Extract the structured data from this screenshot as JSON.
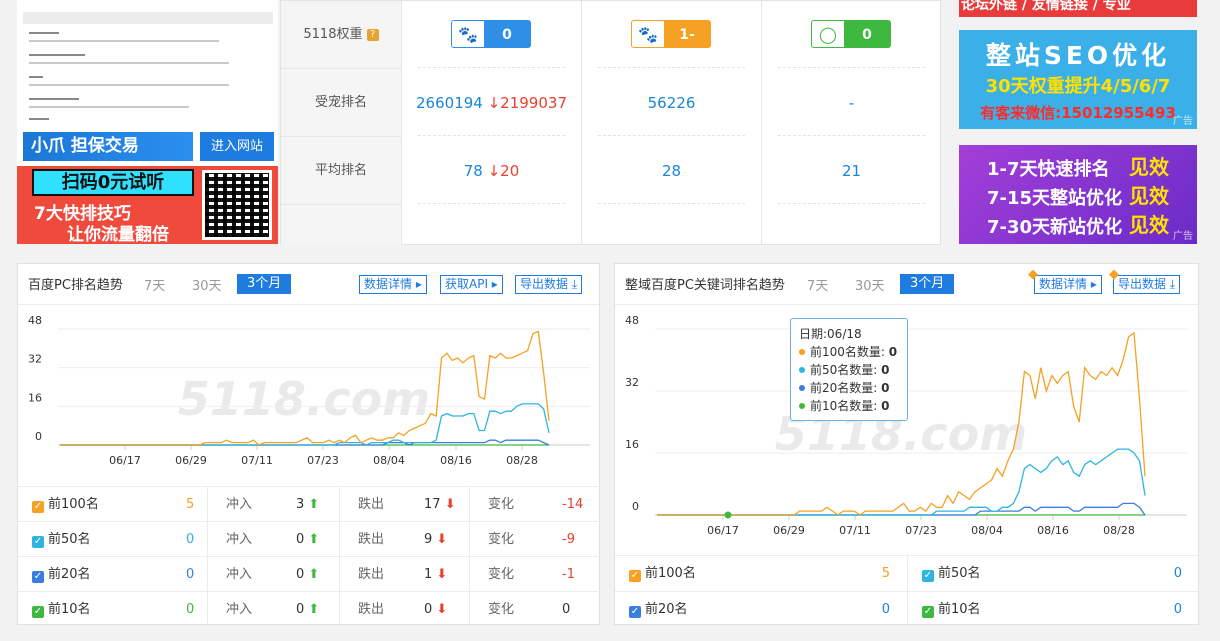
{
  "ads": {
    "enter_site": "进入网站",
    "xiaozhua": "小爪 担保交易",
    "trial_highlight": "扫码0元试听",
    "trial_line2": "7大快排技巧",
    "trial_line3": "让你流量翻倍",
    "right_top": "论坛外链 / 友情链接 / 专业",
    "seo_title": "整站SEO优化",
    "seo_sub": "30天权重提升4/5/6/7",
    "seo_contact": "有客来微信:15012955493",
    "rank_lines": [
      "1-7天快速排名",
      "7-15天整站优化",
      "7-30天新站优化"
    ],
    "rank_tag": "见效",
    "ad_tag": "广告"
  },
  "weights": {
    "label_weight": "5118权重",
    "help": "?",
    "label_rank": "受宠排名",
    "label_avg": "平均排名",
    "cols": [
      {
        "badge": "0",
        "color": "#2f8fe6",
        "icon": "paw-icon",
        "rank": "2660194",
        "rank_change": "↓2199037",
        "avg": "78",
        "avg_change": "↓20"
      },
      {
        "badge": "1-",
        "color": "#f5a123",
        "icon": "paw-icon",
        "rank": "56226",
        "rank_change": "",
        "avg": "28",
        "avg_change": ""
      },
      {
        "badge": "0",
        "color": "#3fb83f",
        "icon": "ring-icon",
        "rank": "-",
        "rank_change": "",
        "avg": "21",
        "avg_change": ""
      }
    ]
  },
  "left_chart": {
    "title": "百度PC排名趋势",
    "tabs": [
      "7天",
      "30天",
      "3个月"
    ],
    "active_tab": "3个月",
    "buttons": [
      "数据详情 ▸",
      "获取API ▸",
      "导出数据 ⤓"
    ],
    "stats": [
      {
        "name": "前100名",
        "color": "#f5a123",
        "count": "5",
        "in_label": "冲入",
        "in": "3",
        "out_label": "跌出",
        "out": "17",
        "chg_label": "变化",
        "chg": "-14"
      },
      {
        "name": "前50名",
        "color": "#2fb4e0",
        "count": "0",
        "in_label": "冲入",
        "in": "0",
        "out_label": "跌出",
        "out": "9",
        "chg_label": "变化",
        "chg": "-9"
      },
      {
        "name": "前20名",
        "color": "#3a7fe0",
        "count": "0",
        "in_label": "冲入",
        "in": "0",
        "out_label": "跌出",
        "out": "1",
        "chg_label": "变化",
        "chg": "-1"
      },
      {
        "name": "前10名",
        "color": "#3fb83f",
        "count": "0",
        "in_label": "冲入",
        "in": "0",
        "out_label": "跌出",
        "out": "0",
        "chg_label": "变化",
        "chg": "0"
      }
    ]
  },
  "right_chart": {
    "title": "整域百度PC关键词排名趋势",
    "tabs": [
      "7天",
      "30天",
      "3个月"
    ],
    "active_tab": "3个月",
    "buttons": [
      "数据详情 ▸",
      "导出数据 ⤓"
    ],
    "tooltip": {
      "date": "日期:06/18",
      "rows": [
        {
          "label": "前100名数量:",
          "value": "0",
          "color": "#f5a123"
        },
        {
          "label": "前50名数量:",
          "value": "0",
          "color": "#2fb4e0"
        },
        {
          "label": "前20名数量:",
          "value": "0",
          "color": "#3a7fe0"
        },
        {
          "label": "前10名数量:",
          "value": "0",
          "color": "#3fb83f"
        }
      ]
    },
    "legend": [
      {
        "name": "前100名",
        "value": "5",
        "color": "#f5a123"
      },
      {
        "name": "前50名",
        "value": "0",
        "color": "#2fb4e0"
      },
      {
        "name": "前20名",
        "value": "0",
        "color": "#3a7fe0"
      },
      {
        "name": "前10名",
        "value": "0",
        "color": "#3fb83f"
      }
    ]
  },
  "watermark": "5118.com",
  "chart_data": [
    {
      "type": "line",
      "title": "百度PC排名趋势",
      "x_ticks": [
        "06/17",
        "06/29",
        "07/11",
        "07/23",
        "08/04",
        "08/16",
        "08/28"
      ],
      "y_ticks": [
        0,
        16,
        32,
        48
      ],
      "ylim": [
        0,
        48
      ],
      "series": [
        {
          "name": "前100名",
          "color": "#f5a123",
          "values": [
            0,
            0,
            0,
            0,
            0,
            0,
            0,
            0,
            0,
            0,
            0,
            0,
            0,
            0,
            0,
            0,
            0,
            0,
            0,
            0,
            0,
            0,
            0,
            0,
            0,
            0,
            0,
            1,
            1,
            1,
            1,
            2,
            1,
            1,
            1,
            1,
            2,
            0,
            1,
            1,
            1,
            1,
            1,
            1,
            1,
            2,
            3,
            1,
            1,
            1,
            2,
            1,
            2,
            1,
            3,
            4,
            1,
            2,
            3,
            2,
            2,
            3,
            3,
            5,
            4,
            6,
            7,
            8,
            9,
            13,
            12,
            36,
            38,
            35,
            36,
            34,
            36,
            37,
            20,
            19,
            37,
            36,
            38,
            36,
            36,
            37,
            38,
            39,
            46,
            47,
            30,
            10
          ]
        },
        {
          "name": "前50名",
          "color": "#2fb4e0",
          "values": [
            0,
            0,
            0,
            0,
            0,
            0,
            0,
            0,
            0,
            0,
            0,
            0,
            0,
            0,
            0,
            0,
            0,
            0,
            0,
            0,
            0,
            0,
            0,
            0,
            0,
            0,
            0,
            0,
            0,
            0,
            0,
            0,
            0,
            0,
            0,
            0,
            0,
            0,
            0,
            0,
            0,
            0,
            0,
            0,
            0,
            0,
            0,
            0,
            0,
            0,
            0,
            0,
            1,
            1,
            1,
            1,
            1,
            0,
            1,
            1,
            1,
            1,
            2,
            2,
            1,
            1,
            1,
            1,
            1,
            1,
            2,
            12,
            13,
            12,
            12,
            12,
            13,
            13,
            6,
            6,
            14,
            14,
            13,
            14,
            14,
            16,
            17,
            17,
            17,
            17,
            15,
            5
          ]
        },
        {
          "name": "前20名",
          "color": "#3a7fe0",
          "values": [
            0,
            0,
            0,
            0,
            0,
            0,
            0,
            0,
            0,
            0,
            0,
            0,
            0,
            0,
            0,
            0,
            0,
            0,
            0,
            0,
            0,
            0,
            0,
            0,
            0,
            0,
            0,
            0,
            0,
            0,
            0,
            0,
            0,
            0,
            0,
            0,
            0,
            0,
            0,
            0,
            0,
            0,
            0,
            0,
            0,
            0,
            0,
            0,
            0,
            0,
            0,
            0,
            0,
            0,
            0,
            0,
            0,
            0,
            0,
            0,
            0,
            1,
            1,
            1,
            1,
            0,
            1,
            1,
            1,
            1,
            1,
            1,
            1,
            1,
            1,
            1,
            1,
            1,
            1,
            1,
            2,
            2,
            1,
            2,
            2,
            2,
            2,
            2,
            2,
            2,
            1,
            0
          ]
        },
        {
          "name": "前10名",
          "color": "#3fb83f",
          "values": [
            0,
            0,
            0,
            0,
            0,
            0,
            0,
            0,
            0,
            0,
            0,
            0,
            0,
            0,
            0,
            0,
            0,
            0,
            0,
            0,
            0,
            0,
            0,
            0,
            0,
            0,
            0,
            0,
            0,
            0,
            0,
            0,
            0,
            0,
            0,
            0,
            0,
            0,
            0,
            0,
            0,
            0,
            0,
            0,
            0,
            0,
            0,
            0,
            0,
            0,
            0,
            0,
            0,
            0,
            0,
            0,
            0,
            0,
            0,
            0,
            0,
            0,
            0,
            0,
            0,
            0,
            0,
            0,
            0,
            0,
            0,
            0,
            0,
            0,
            0,
            0,
            0,
            0,
            0,
            0,
            0,
            0,
            0,
            0,
            0,
            0,
            0,
            0,
            0,
            0,
            0,
            0
          ]
        }
      ]
    },
    {
      "type": "line",
      "title": "整域百度PC关键词排名趋势",
      "x_ticks": [
        "06/17",
        "06/29",
        "07/11",
        "07/23",
        "08/04",
        "08/16",
        "08/28"
      ],
      "y_ticks": [
        0,
        16,
        32,
        48
      ],
      "ylim": [
        0,
        48
      ],
      "series": [
        {
          "name": "前100名",
          "color": "#f5a123",
          "values": [
            0,
            0,
            0,
            0,
            0,
            0,
            0,
            0,
            0,
            0,
            0,
            0,
            0,
            0,
            0,
            0,
            0,
            0,
            0,
            0,
            0,
            0,
            0,
            0,
            0,
            0,
            1,
            1,
            1,
            1,
            1,
            2,
            1,
            0,
            1,
            1,
            1,
            0,
            1,
            1,
            1,
            1,
            1,
            1,
            2,
            3,
            1,
            1,
            2,
            1,
            3,
            2,
            2,
            5,
            3,
            6,
            5,
            4,
            6,
            7,
            8,
            9,
            12,
            10,
            14,
            17,
            24,
            37,
            36,
            30,
            38,
            32,
            36,
            34,
            36,
            37,
            28,
            24,
            38,
            36,
            35,
            37,
            36,
            38,
            36,
            40,
            46,
            47,
            30,
            10
          ]
        },
        {
          "name": "前50名",
          "color": "#2fb4e0",
          "values": [
            0,
            0,
            0,
            0,
            0,
            0,
            0,
            0,
            0,
            0,
            0,
            0,
            0,
            0,
            0,
            0,
            0,
            0,
            0,
            0,
            0,
            0,
            0,
            0,
            0,
            0,
            0,
            0,
            0,
            0,
            0,
            0,
            0,
            0,
            0,
            0,
            0,
            0,
            0,
            0,
            0,
            0,
            0,
            0,
            0,
            0,
            0,
            0,
            0,
            0,
            0,
            1,
            1,
            1,
            1,
            1,
            1,
            2,
            2,
            2,
            2,
            1,
            1,
            2,
            2,
            3,
            6,
            12,
            13,
            12,
            11,
            12,
            14,
            15,
            13,
            14,
            11,
            10,
            13,
            14,
            13,
            14,
            15,
            16,
            17,
            17,
            17,
            16,
            14,
            5
          ]
        },
        {
          "name": "前20名",
          "color": "#3a7fe0",
          "values": [
            0,
            0,
            0,
            0,
            0,
            0,
            0,
            0,
            0,
            0,
            0,
            0,
            0,
            0,
            0,
            0,
            0,
            0,
            0,
            0,
            0,
            0,
            0,
            0,
            0,
            0,
            0,
            0,
            0,
            0,
            0,
            0,
            0,
            0,
            0,
            0,
            0,
            0,
            0,
            0,
            0,
            0,
            0,
            0,
            0,
            0,
            0,
            0,
            0,
            0,
            0,
            0,
            0,
            0,
            0,
            0,
            0,
            0,
            0,
            1,
            1,
            1,
            1,
            1,
            1,
            1,
            1,
            2,
            2,
            1,
            2,
            2,
            2,
            2,
            2,
            2,
            1,
            1,
            2,
            2,
            2,
            2,
            2,
            2,
            2,
            3,
            3,
            3,
            2,
            0
          ]
        },
        {
          "name": "前10名",
          "color": "#3fb83f",
          "values": [
            0,
            0,
            0,
            0,
            0,
            0,
            0,
            0,
            0,
            0,
            0,
            0,
            0,
            0,
            0,
            0,
            0,
            0,
            0,
            0,
            0,
            0,
            0,
            0,
            0,
            0,
            0,
            0,
            0,
            0,
            0,
            0,
            0,
            0,
            0,
            0,
            0,
            0,
            0,
            0,
            0,
            0,
            0,
            0,
            0,
            0,
            0,
            0,
            0,
            0,
            0,
            0,
            0,
            0,
            0,
            0,
            0,
            0,
            0,
            0,
            0,
            0,
            0,
            0,
            0,
            0,
            0,
            0,
            0,
            0,
            0,
            0,
            0,
            0,
            0,
            0,
            0,
            0,
            0,
            0,
            0,
            0,
            0,
            0,
            0,
            0,
            0,
            0,
            0,
            0
          ]
        }
      ]
    }
  ]
}
